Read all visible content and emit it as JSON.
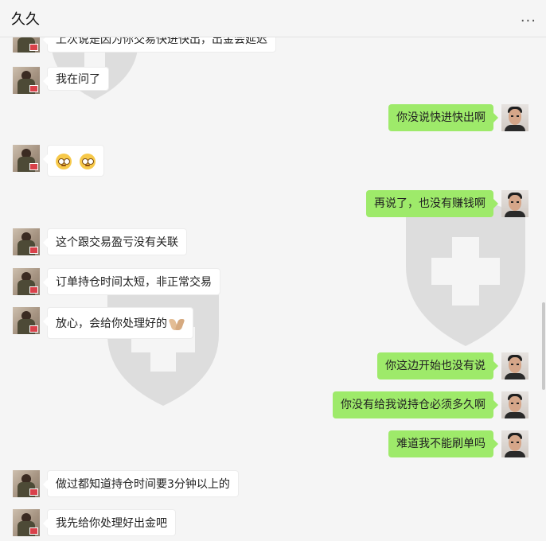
{
  "header": {
    "title": "久久",
    "more_label": "..."
  },
  "messages": [
    {
      "side": "left",
      "text": "上次说是因为你交易快进快出，出金会延迟"
    },
    {
      "side": "left",
      "text": "我在问了"
    },
    {
      "side": "right",
      "text": "你没说快进快出啊"
    },
    {
      "side": "left",
      "text": "",
      "emoji": "flushed-face x2"
    },
    {
      "side": "right",
      "text": "再说了，也没有赚钱啊"
    },
    {
      "side": "left",
      "text": "这个跟交易盈亏没有关联"
    },
    {
      "side": "left",
      "text": "订单持仓时间太短，非正常交易"
    },
    {
      "side": "left",
      "text": "放心，会给你处理好的",
      "emoji": "pray-hands"
    },
    {
      "side": "right",
      "text": "你这边开始也没有说"
    },
    {
      "side": "right",
      "text": "你没有给我说持仓必须多久啊"
    },
    {
      "side": "right",
      "text": "难道我不能刷单吗"
    },
    {
      "side": "left",
      "text": "做过都知道持仓时间要3分钟以上的"
    },
    {
      "side": "left",
      "text": "我先给你处理好出金吧"
    }
  ],
  "colors": {
    "self_bubble": "#9eea6a",
    "other_bubble": "#ffffff",
    "background": "#f5f5f5"
  },
  "icons": {
    "left_avatar": "contact-avatar",
    "right_avatar": "user-avatar",
    "more": "more-dots-icon"
  }
}
